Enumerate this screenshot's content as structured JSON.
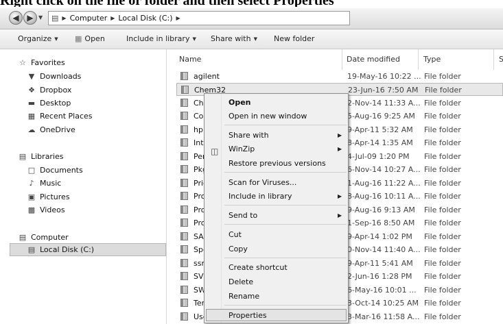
{
  "caption": "Right click on the file or folder and then select Properties",
  "address": {
    "crumbs": [
      "Computer",
      "Local Disk (C:)"
    ]
  },
  "toolbar": {
    "organize": "Organize",
    "open": "Open",
    "include": "Include in library",
    "share": "Share with",
    "new_folder": "New folder"
  },
  "nav": {
    "favorites": "Favorites",
    "downloads": "Downloads",
    "dropbox": "Dropbox",
    "desktop": "Desktop",
    "recent": "Recent Places",
    "onedrive": "OneDrive",
    "libraries": "Libraries",
    "documents": "Documents",
    "music": "Music",
    "pictures": "Pictures",
    "videos": "Videos",
    "computer": "Computer",
    "local_disk": "Local Disk (C:)"
  },
  "columns": {
    "name": "Name",
    "date": "Date modified",
    "type": "Type",
    "size": "S"
  },
  "files": [
    {
      "name": "agilent",
      "date": "19-May-16 10:22 ...",
      "type": "File folder"
    },
    {
      "name": "Chem32",
      "date": "23-Jun-16 7:50 AM",
      "type": "File folder"
    },
    {
      "name": "Che",
      "date": "2-Nov-14 11:33 A...",
      "type": "File folder"
    },
    {
      "name": "Cor",
      "date": "5-Aug-16 9:25 AM",
      "type": "File folder"
    },
    {
      "name": "hp",
      "date": "9-Apr-11 5:32 AM",
      "type": "File folder"
    },
    {
      "name": "Inte",
      "date": "8-Apr-14 1:35 AM",
      "type": "File folder"
    },
    {
      "name": "Perf",
      "date": "4-Jul-09 1:20 PM",
      "type": "File folder"
    },
    {
      "name": "Pkg",
      "date": "6-Nov-14 10:27 A...",
      "type": "File folder"
    },
    {
      "name": "Pric",
      "date": "1-Aug-16 11:22 A...",
      "type": "File folder"
    },
    {
      "name": "Pro",
      "date": "8-Aug-16 10:11 A...",
      "type": "File folder"
    },
    {
      "name": "Pro",
      "date": "9-Aug-16 9:13 AM",
      "type": "File folder"
    },
    {
      "name": "Pro",
      "date": "1-Sep-16 8:50 AM",
      "type": "File folder"
    },
    {
      "name": "SAP",
      "date": "9-Apr-14 1:02 PM",
      "type": "File folder"
    },
    {
      "name": "Spe",
      "date": "0-Nov-14 11:40 A...",
      "type": "File folder"
    },
    {
      "name": "ssm",
      "date": "9-Apr-11 5:41 AM",
      "type": "File folder"
    },
    {
      "name": "SVR",
      "date": "2-Jun-16 1:28 PM",
      "type": "File folder"
    },
    {
      "name": "SWS",
      "date": "6-May-16 10:01 ...",
      "type": "File folder"
    },
    {
      "name": "Ten",
      "date": "3-Oct-14 10:25 AM",
      "type": "File folder"
    },
    {
      "name": "Use",
      "date": "3-Mar-16 11:58 A...",
      "type": "File folder"
    }
  ],
  "menu": {
    "open": "Open",
    "open_new_window": "Open in new window",
    "share_with": "Share with",
    "winzip": "WinZip",
    "restore": "Restore previous versions",
    "scan": "Scan for Viruses...",
    "include_library": "Include in library",
    "send_to": "Send to",
    "cut": "Cut",
    "copy": "Copy",
    "create_shortcut": "Create shortcut",
    "delete": "Delete",
    "rename": "Rename",
    "properties": "Properties"
  }
}
